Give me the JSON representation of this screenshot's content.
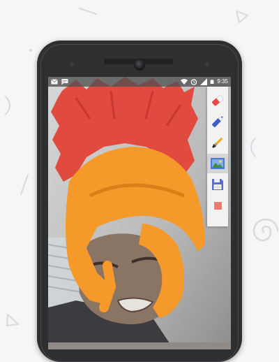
{
  "statusbar": {
    "time": "9:35",
    "icons_left": [
      "gmail-icon",
      "message-icon"
    ],
    "icons_right": [
      "wifi-icon",
      "alarm-icon",
      "signal-icon",
      "battery-icon"
    ]
  },
  "toolbar": {
    "tools": [
      "eraser",
      "marker",
      "brush",
      "image",
      "save",
      "color"
    ],
    "active_tool": "image",
    "selected_color": "#f07a6e"
  },
  "colors": {
    "background": "#f6f6f7",
    "phone_body": "#2e2f31",
    "paint_red": "#e14a3f",
    "paint_orange": "#f59a2a"
  }
}
